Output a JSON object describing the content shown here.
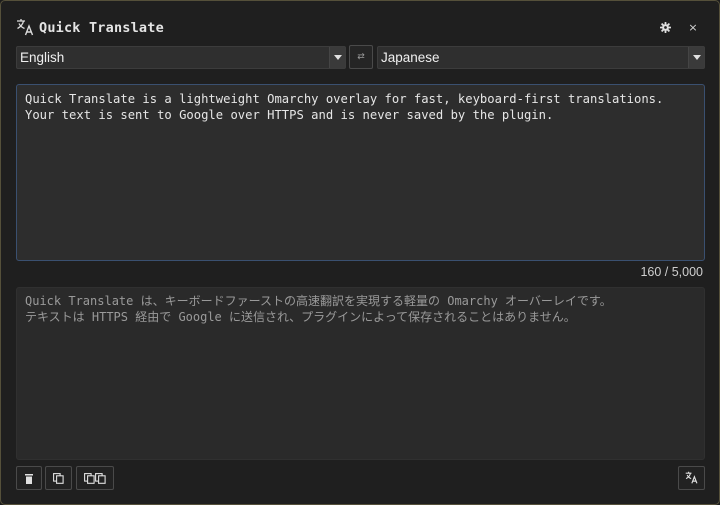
{
  "window": {
    "title": "Quick Translate",
    "settings_icon": "gear-icon",
    "close_label": "×"
  },
  "languages": {
    "source": "English",
    "target": "Japanese",
    "swap_label": "⇄"
  },
  "source": {
    "lines": [
      "Quick Translate is a lightweight Omarchy overlay for fast, keyboard-first translations.",
      "Your text is sent to Google over HTTPS and is never saved by the plugin."
    ],
    "char_count": "160 / 5,000"
  },
  "target": {
    "lines": [
      "Quick Translate は、キーボードファーストの高速翻訳を実現する軽量の Omarchy オーバーレイです。",
      "テキストは HTTPS 経由で Google に送信され、プラグインによって保存されることはありません。"
    ]
  },
  "footer": {
    "clear_icon": "trash-icon",
    "copy_icon": "copy-icon",
    "copy_both_icon": "copy-both-icon",
    "translate_icon": "translate-icon"
  },
  "colors": {
    "background": "#1f1f1f",
    "source_border": "#3a5070",
    "window_border": "#55503a"
  }
}
